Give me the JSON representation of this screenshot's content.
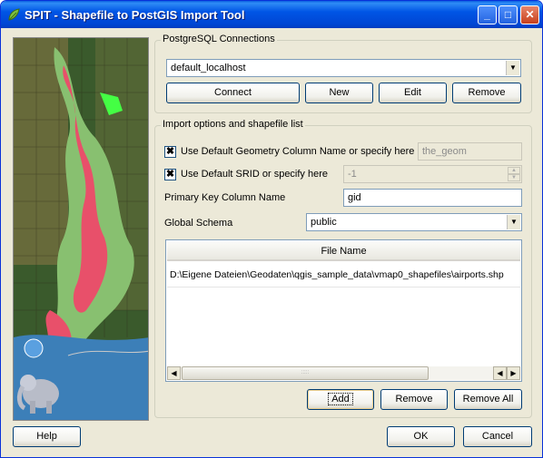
{
  "window": {
    "title": "SPIT - Shapefile to PostGIS Import Tool",
    "controls": {
      "minimize": "_",
      "maximize": "□",
      "close": "✕"
    }
  },
  "connections": {
    "legend": "PostgreSQL Connections",
    "selected": "default_localhost",
    "buttons": {
      "connect": "Connect",
      "new": "New",
      "edit": "Edit",
      "remove": "Remove"
    }
  },
  "import_options": {
    "legend": "Import options and shapefile list",
    "geometry": {
      "label": "Use Default Geometry Column Name or specify here",
      "checked": true,
      "value": "the_geom"
    },
    "srid": {
      "label": "Use Default SRID or specify here",
      "checked": true,
      "value": "-1"
    },
    "primary_key": {
      "label": "Primary Key Column Name",
      "value": "gid"
    },
    "schema": {
      "label": "Global Schema",
      "selected": "public"
    },
    "file_table": {
      "header": "File Name",
      "rows": [
        "D:\\Eigene Dateien\\Geodaten\\qgis_sample_data\\vmap0_shapefiles\\airports.shp"
      ]
    },
    "buttons": {
      "add": "Add",
      "remove": "Remove",
      "remove_all": "Remove All"
    }
  },
  "footer": {
    "help": "Help",
    "ok": "OK",
    "cancel": "Cancel"
  },
  "check_mark": "✖",
  "icons": {
    "dropdown": "chevron-down-icon",
    "scroll_left": "arrow-left-icon",
    "scroll_right": "arrow-right-icon",
    "app": "qgis-leaf-icon"
  },
  "colors": {
    "titlebar": "#0055e5",
    "window_bg": "#ece9d8",
    "map_land": "#88c070",
    "map_zone": "#e8506a"
  }
}
